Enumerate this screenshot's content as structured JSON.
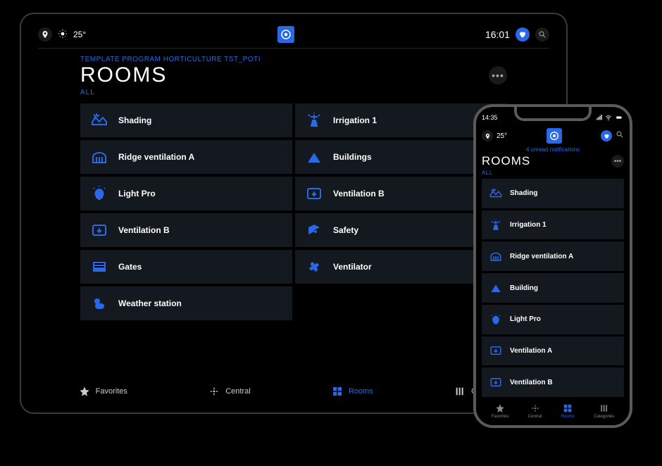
{
  "tablet": {
    "status": {
      "temp": "25°",
      "time": "16:01"
    },
    "breadcrumb": "TEMPLATE PROGRAM HORTICULTURE TST_POTI",
    "title": "ROOMS",
    "filter": "ALL",
    "rooms": [
      {
        "label": "Shading",
        "icon": "shading"
      },
      {
        "label": "Irrigation 1",
        "icon": "irrigation"
      },
      {
        "label": "Ridge ventilation A",
        "icon": "ridge"
      },
      {
        "label": "Buildings",
        "icon": "buildings"
      },
      {
        "label": "Light Pro",
        "icon": "light"
      },
      {
        "label": "Ventilation B",
        "icon": "ventbox"
      },
      {
        "label": "Ventilation B",
        "icon": "ventbox"
      },
      {
        "label": "Safety",
        "icon": "safety"
      },
      {
        "label": "Gates",
        "icon": "gates"
      },
      {
        "label": "Ventilator",
        "icon": "fan"
      },
      {
        "label": "Weather station",
        "icon": "weather"
      }
    ],
    "nav": {
      "favorites": "Favorites",
      "central": "Central",
      "rooms": "Rooms",
      "categories": "Categories"
    }
  },
  "phone": {
    "status": {
      "time": "14:35"
    },
    "header": {
      "temp": "25°"
    },
    "notif": "4 unread notifications",
    "title": "ROOMS",
    "filter": "ALL",
    "rooms": [
      {
        "label": "Shading",
        "icon": "shading"
      },
      {
        "label": "Irrigation 1",
        "icon": "irrigation"
      },
      {
        "label": "Ridge ventilation A",
        "icon": "ridge"
      },
      {
        "label": "Building",
        "icon": "buildings"
      },
      {
        "label": "Light Pro",
        "icon": "light"
      },
      {
        "label": "Ventilation A",
        "icon": "ventbox"
      },
      {
        "label": "Ventilation B",
        "icon": "ventbox"
      }
    ],
    "nav": {
      "favorites": "Favorites",
      "central": "Central",
      "rooms": "Rooms",
      "categories": "Categories"
    }
  }
}
